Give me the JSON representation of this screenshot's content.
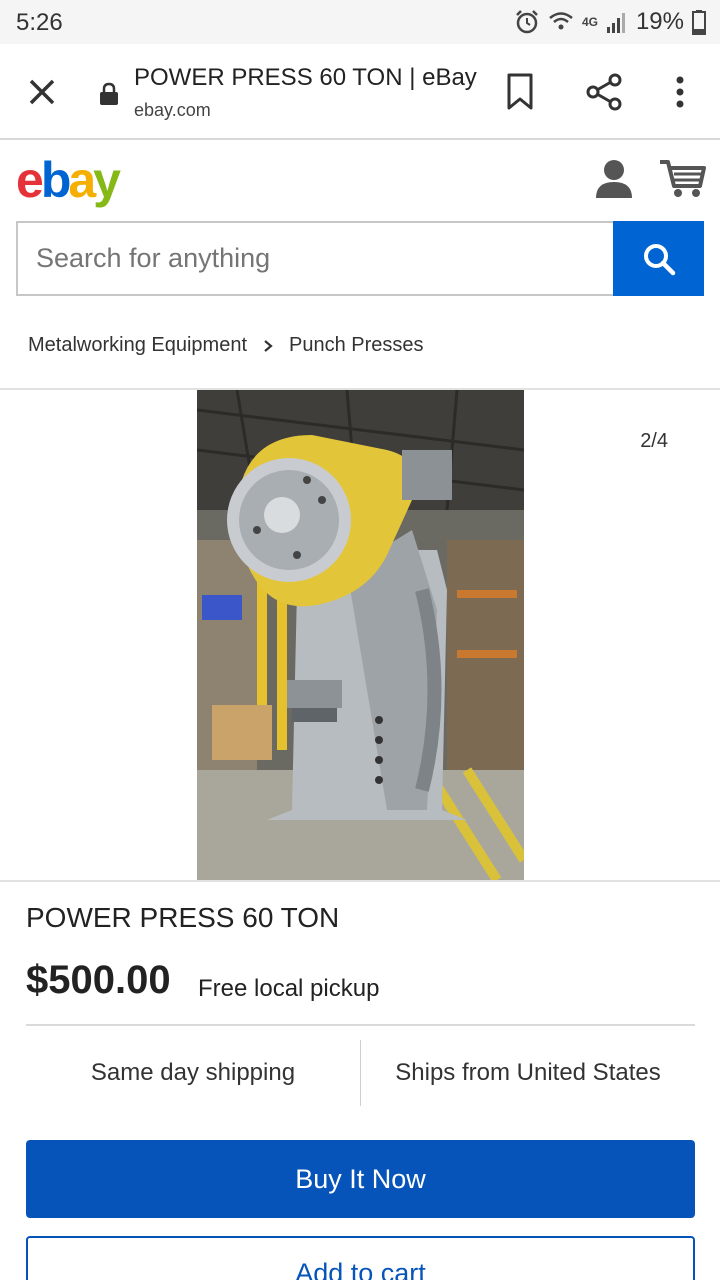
{
  "status_bar": {
    "time": "5:26",
    "network": "4G",
    "battery": "19%",
    "icons": [
      "alarm-icon",
      "wifi-icon",
      "signal-icon",
      "battery-icon"
    ]
  },
  "browser": {
    "page_title": "POWER PRESS 60 TON | eBay",
    "url": "ebay.com",
    "icons": [
      "close-icon",
      "lock-icon",
      "bookmark-icon",
      "share-icon",
      "more-vert-icon"
    ]
  },
  "header": {
    "logo": {
      "e": "e",
      "b": "b",
      "a": "a",
      "y": "y"
    },
    "search_placeholder": "Search for anything",
    "icons": [
      "user-icon",
      "cart-icon",
      "search-icon"
    ]
  },
  "breadcrumb": {
    "items": [
      "Metalworking Equipment",
      "Punch Presses"
    ]
  },
  "gallery": {
    "counter": "2/4"
  },
  "product": {
    "title": "POWER PRESS 60 TON",
    "price": "$500.00",
    "delivery": "Free local pickup",
    "shipping_speed": "Same day shipping",
    "ships_from": "Ships from United States"
  },
  "actions": {
    "buy_now": "Buy It Now",
    "add_to_cart": "Add to cart"
  },
  "colors": {
    "ebay_blue": "#0654ba",
    "search_blue": "#0064d2",
    "logo_red": "#e53238",
    "logo_blue": "#0064d2",
    "logo_yellow": "#f5af02",
    "logo_green": "#86b817"
  }
}
